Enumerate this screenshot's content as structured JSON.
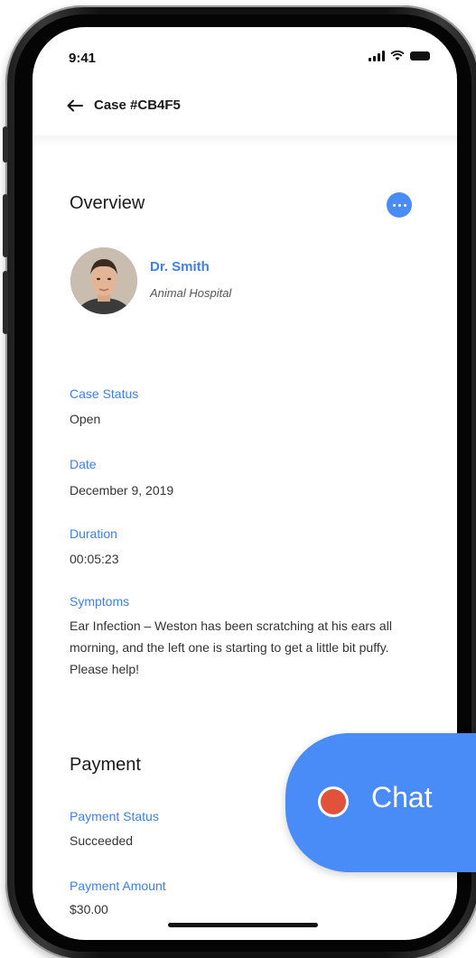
{
  "status_bar": {
    "time": "9:41"
  },
  "header": {
    "title": "Case #CB4F5"
  },
  "overview": {
    "title": "Overview",
    "doctor": {
      "name": "Dr. Smith",
      "organization": "Animal Hospital"
    },
    "fields": [
      {
        "label": "Case Status",
        "value": "Open"
      },
      {
        "label": "Date",
        "value": "December 9, 2019"
      },
      {
        "label": "Duration",
        "value": "00:05:23"
      },
      {
        "label": "Symptoms",
        "value": "Ear Infection – Weston has been scratching at his ears all morning, and the left one is starting to get a little bit puffy. Please help!"
      }
    ]
  },
  "payment": {
    "title": "Payment",
    "fields": [
      {
        "label": "Payment Status",
        "value": "Succeeded"
      },
      {
        "label": "Payment Amount",
        "value": "$30.00"
      }
    ]
  },
  "chat": {
    "label": "Chat"
  },
  "colors": {
    "accent": "#4a8cf7",
    "label_blue": "#3f7fe6",
    "chat_dot": "#e0523b"
  }
}
